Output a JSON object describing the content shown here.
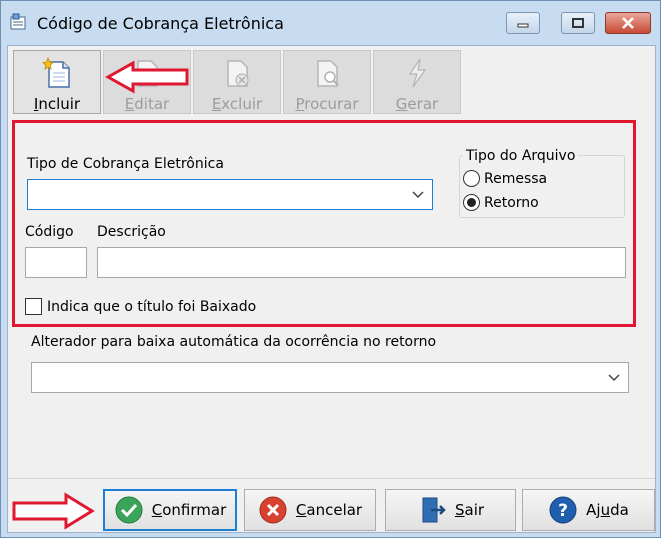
{
  "window": {
    "title": "Código de Cobrança Eletrônica",
    "controls": [
      "minimize-icon",
      "maximize-icon",
      "close-icon"
    ]
  },
  "toolbar": {
    "buttons": [
      {
        "id": "incluir",
        "label": "Incluir",
        "icon": "new-document-icon",
        "enabled": true
      },
      {
        "id": "editar",
        "label": "Editar",
        "icon": "edit-document-icon",
        "enabled": false
      },
      {
        "id": "excluir",
        "label": "Excluir",
        "icon": "delete-document-icon",
        "enabled": false
      },
      {
        "id": "procurar",
        "label": "Procurar",
        "icon": "search-document-icon",
        "enabled": false
      },
      {
        "id": "gerar",
        "label": "Gerar",
        "icon": "generate-icon",
        "enabled": false
      }
    ]
  },
  "form": {
    "tipo_cobranca": {
      "label": "Tipo de Cobrança Eletrônica",
      "value": ""
    },
    "tipo_arquivo": {
      "title": "Tipo do Arquivo",
      "options": [
        {
          "label": "Remessa",
          "selected": false
        },
        {
          "label": "Retorno",
          "selected": true
        }
      ]
    },
    "codigo": {
      "label": "Código",
      "value": ""
    },
    "descricao": {
      "label": "Descrição",
      "value": ""
    },
    "baixado": {
      "label": "Indica que o título foi Baixado",
      "checked": false
    },
    "alterador": {
      "label": "Alterador para baixa automática da ocorrência no retorno",
      "value": ""
    }
  },
  "footer": {
    "buttons": [
      {
        "id": "confirmar",
        "label": "Confirmar",
        "icon": "check-circle-icon"
      },
      {
        "id": "cancelar",
        "label": "Cancelar",
        "icon": "cancel-circle-icon"
      },
      {
        "id": "sair",
        "label": "Sair",
        "icon": "exit-door-icon"
      },
      {
        "id": "ajuda",
        "label": "Ajuda",
        "icon": "help-circle-icon"
      }
    ]
  },
  "colors": {
    "highlight": "#e0182f",
    "focus": "#1d7fd1",
    "titlebar": "#c7dcf1"
  }
}
